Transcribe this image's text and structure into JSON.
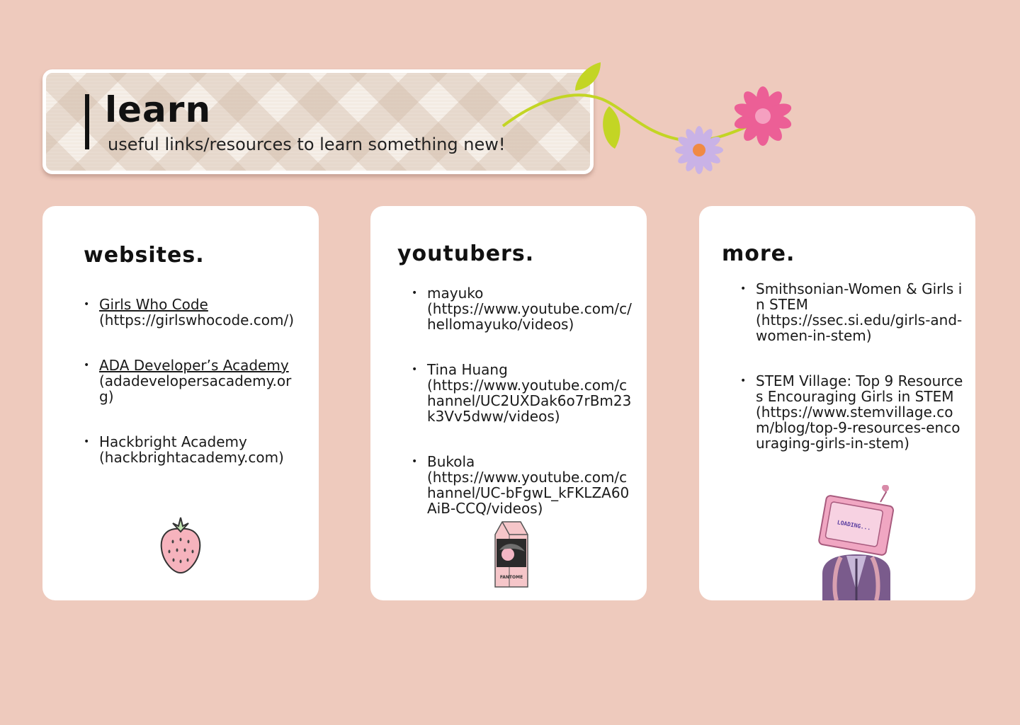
{
  "header": {
    "title": "learn",
    "subtitle": "useful links/resources to learn something new!"
  },
  "websites": {
    "heading": "websites.",
    "items": [
      {
        "name": "Girls Who Code",
        "url": "(https://girlswhocode.com/)"
      },
      {
        "name": "ADA Developer’s Academy",
        "url": "(adadevelopersacademy.org)"
      },
      {
        "name": "Hackbright Academy",
        "url": "(hackbrightacademy.com)"
      }
    ]
  },
  "youtubers": {
    "heading": "youtubers.",
    "items": [
      {
        "name": "mayuko",
        "url": "(https://www.youtube.com/c/hellomayuko/videos)"
      },
      {
        "name": "Tina Huang",
        "url": "(https://www.youtube.com/channel/UC2UXDak6o7rBm23k3Vv5dww/videos)"
      },
      {
        "name": "Bukola",
        "url": "(https://www.youtube.com/channel/UC-bFgwL_kFKLZA60AiB-CCQ/videos)"
      }
    ]
  },
  "more": {
    "heading": "more.",
    "items": [
      {
        "name": "Smithsonian-Women & Girls in STEM",
        "url": "(https://ssec.si.edu/girls-and-women-in-stem)"
      },
      {
        "name": "STEM Village: Top 9 Resources Encouraging Girls in STEM",
        "url": "(https://www.stemvillage.com/blog/top-9-resources-encouraging-girls-in-stem)"
      }
    ]
  },
  "stickers": {
    "tv_screen_text": "LOADING...",
    "milk_label": "FANTOME"
  },
  "colors": {
    "background": "#eecabd",
    "card": "#ffffff",
    "flower_pink": "#ec5f96",
    "flower_lavender": "#c9b2e6",
    "stem_green": "#c3d524"
  }
}
